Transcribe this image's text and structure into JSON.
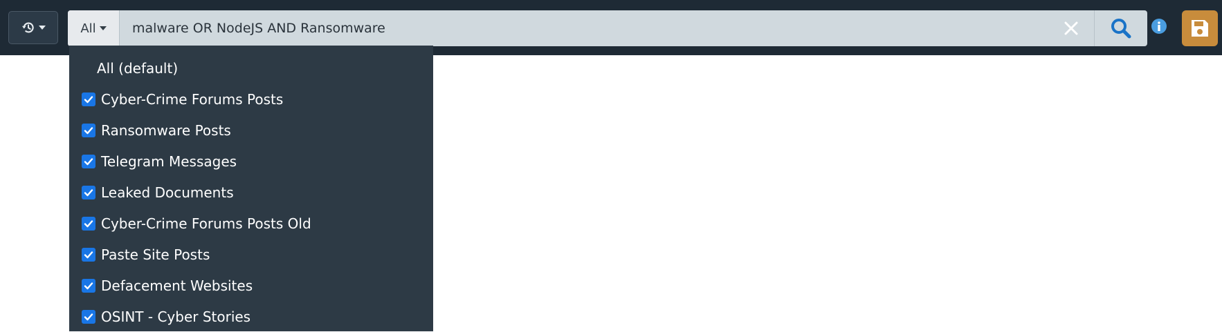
{
  "toolbar": {
    "history_icon": "history-icon",
    "scope_label": "All",
    "search_value": "malware OR NodeJS AND Ransomware",
    "clear_icon": "close-icon",
    "search_icon": "search-icon",
    "info_icon": "info-icon",
    "save_icon": "save-icon"
  },
  "dropdown": {
    "default_label": "All (default)",
    "items": [
      {
        "label": "Cyber-Crime Forums Posts",
        "checked": true
      },
      {
        "label": "Ransomware Posts",
        "checked": true
      },
      {
        "label": "Telegram Messages",
        "checked": true
      },
      {
        "label": "Leaked Documents",
        "checked": true
      },
      {
        "label": "Cyber-Crime Forums Posts Old",
        "checked": true
      },
      {
        "label": "Paste Site Posts",
        "checked": true
      },
      {
        "label": "Defacement Websites",
        "checked": true
      },
      {
        "label": "OSINT - Cyber Stories",
        "checked": true
      }
    ]
  },
  "colors": {
    "topbar": "#1e2a35",
    "dropdown_bg": "#2d3a45",
    "checkbox": "#1976e6",
    "search_icon": "#1a73c7",
    "save_button": "#c88c3c"
  }
}
